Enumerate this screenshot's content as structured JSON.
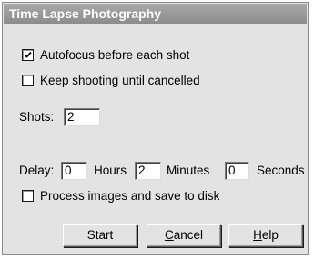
{
  "dialog": {
    "title": "Time Lapse Photography"
  },
  "options": {
    "autofocus": {
      "label": "Autofocus before each shot",
      "checked": true
    },
    "keep_shooting": {
      "label": "Keep shooting until cancelled",
      "checked": false
    },
    "process_images": {
      "label": "Process images and save to disk",
      "checked": false
    }
  },
  "shots": {
    "label": "Shots:",
    "value": "2"
  },
  "delay": {
    "label": "Delay:",
    "hours_value": "0",
    "hours_label": "Hours",
    "minutes_value": "2",
    "minutes_label": "Minutes",
    "seconds_value": "0",
    "seconds_label": "Seconds"
  },
  "buttons": {
    "start": {
      "label": "Start"
    },
    "cancel": {
      "label": "Cancel",
      "mnemonic": "C",
      "rest": "ancel"
    },
    "help": {
      "label": "Help",
      "mnemonic": "H",
      "rest": "elp"
    }
  }
}
